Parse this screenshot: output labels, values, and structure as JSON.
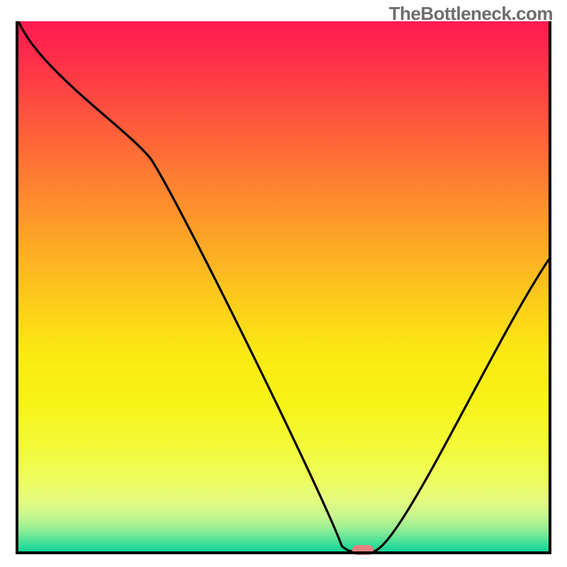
{
  "watermark": "TheBottleneck.com",
  "chart_data": {
    "type": "line",
    "title": "",
    "xlabel": "",
    "ylabel": "",
    "xlim": [
      0,
      100
    ],
    "ylim": [
      0,
      100
    ],
    "x": [
      0,
      25,
      61,
      63,
      67,
      100
    ],
    "y": [
      100,
      74,
      1,
      0,
      0,
      55
    ],
    "marker": {
      "x": 65,
      "y": 0
    },
    "gradient_stops": [
      {
        "offset": 0,
        "color": "#ff1a51"
      },
      {
        "offset": 0.06,
        "color": "#ff2b4b"
      },
      {
        "offset": 0.2,
        "color": "#fe5c3b"
      },
      {
        "offset": 0.35,
        "color": "#fd902c"
      },
      {
        "offset": 0.5,
        "color": "#fcc31d"
      },
      {
        "offset": 0.62,
        "color": "#fbe813"
      },
      {
        "offset": 0.72,
        "color": "#f7f318"
      },
      {
        "offset": 0.8,
        "color": "#f3fa37"
      },
      {
        "offset": 0.86,
        "color": "#eefc5b"
      },
      {
        "offset": 0.905,
        "color": "#e3fb80"
      },
      {
        "offset": 0.935,
        "color": "#c4f68f"
      },
      {
        "offset": 0.958,
        "color": "#94ee95"
      },
      {
        "offset": 0.975,
        "color": "#5fe499"
      },
      {
        "offset": 0.992,
        "color": "#27da98"
      },
      {
        "offset": 1.0,
        "color": "#13d697"
      }
    ]
  }
}
